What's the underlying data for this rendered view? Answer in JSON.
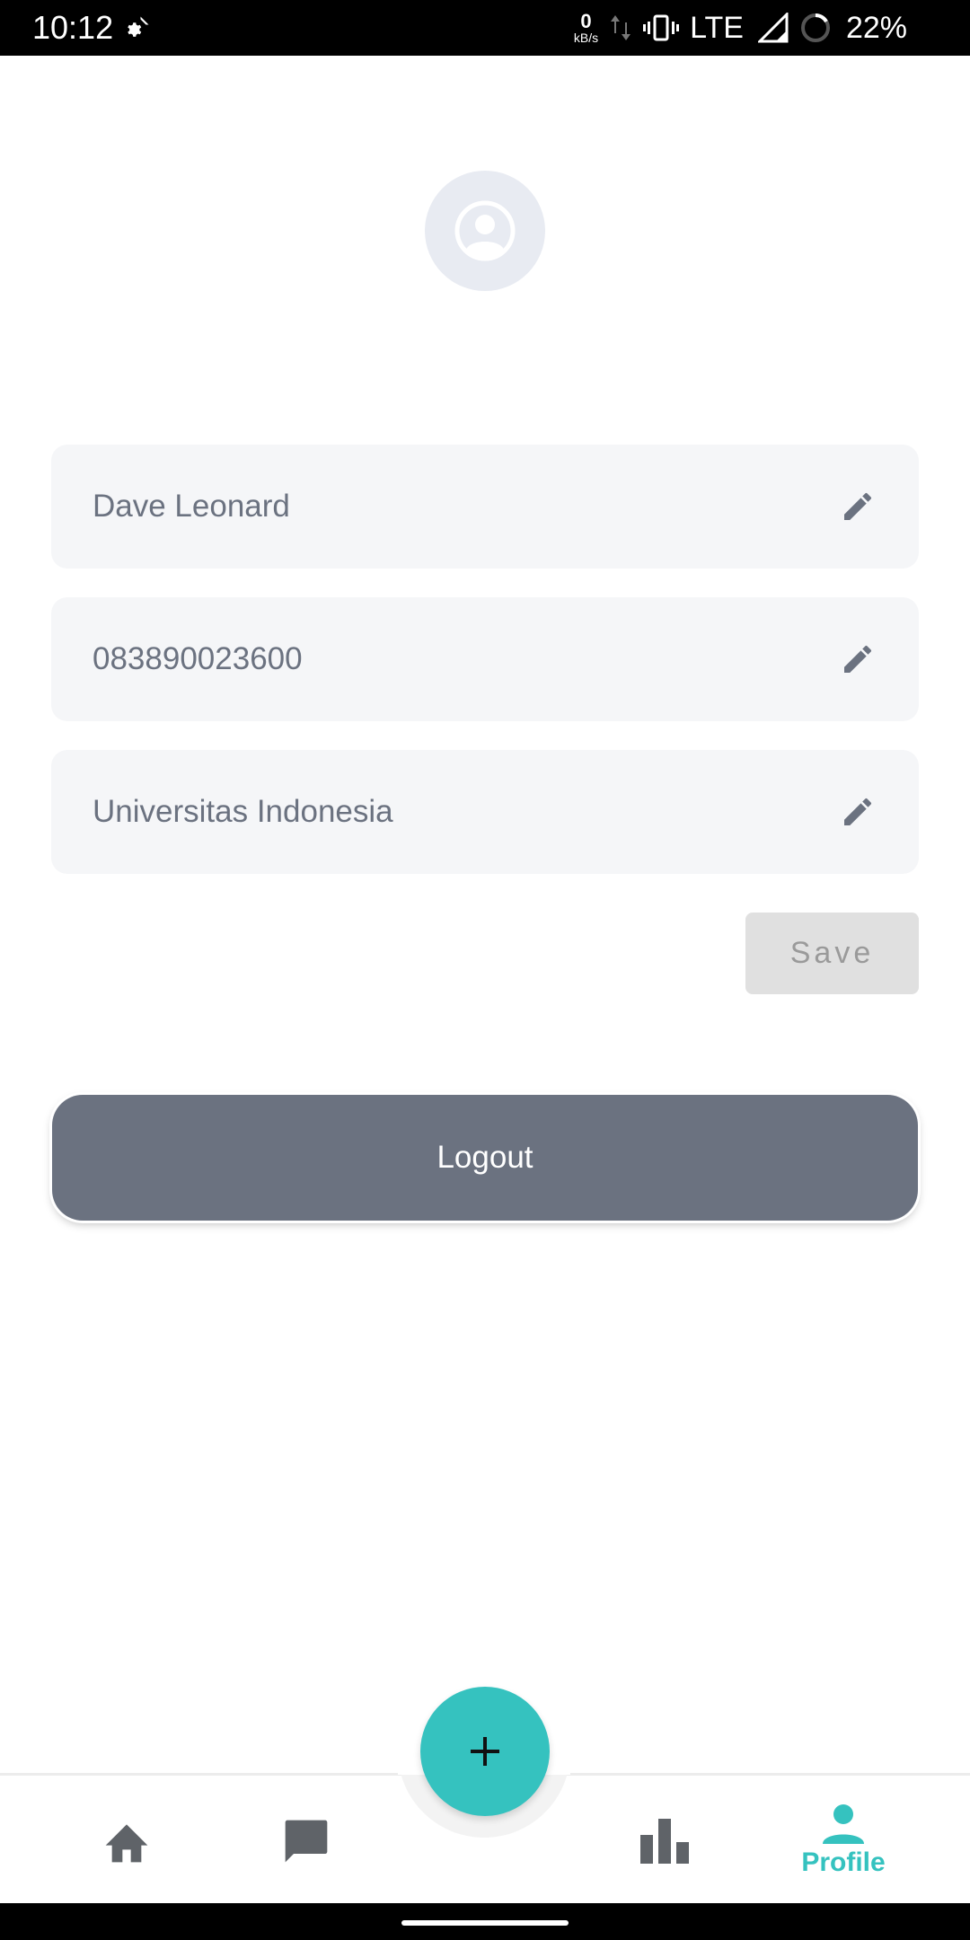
{
  "status_bar": {
    "time": "10:12",
    "net_speed_value": "0",
    "net_speed_unit": "kB/s",
    "network": "LTE",
    "battery": "22%"
  },
  "profile": {
    "name": "Dave Leonard",
    "phone": "083890023600",
    "institution": "Universitas Indonesia"
  },
  "actions": {
    "save_label": "Save",
    "logout_label": "Logout"
  },
  "bottom_nav": {
    "profile_label": "Profile"
  },
  "colors": {
    "accent": "#35c2bf",
    "logout_bg": "#6b7280",
    "field_bg": "#f5f6f8",
    "save_disabled_bg": "#e0e0e0"
  }
}
